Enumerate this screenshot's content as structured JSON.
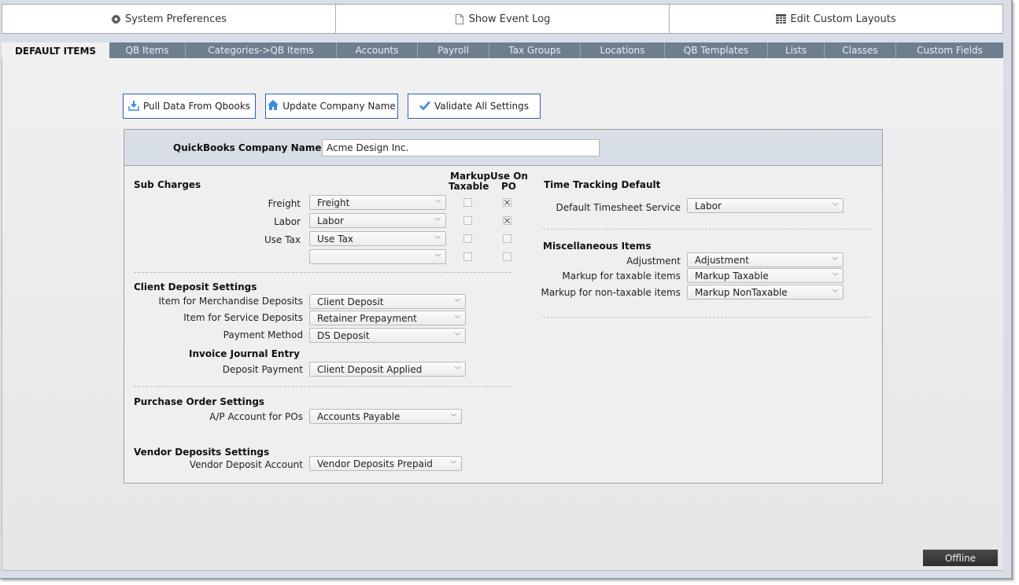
{
  "toolbar": {
    "items": [
      {
        "label": "System Preferences",
        "icon": "gear-icon"
      },
      {
        "label": "Show Event Log",
        "icon": "document-icon"
      },
      {
        "label": "Edit Custom Layouts",
        "icon": "table-icon"
      }
    ]
  },
  "tabs": [
    {
      "label": "DEFAULT ITEMS",
      "active": true
    },
    {
      "label": "QB Items"
    },
    {
      "label": "Categories->QB Items"
    },
    {
      "label": "Accounts"
    },
    {
      "label": "Payroll"
    },
    {
      "label": "Tax Groups"
    },
    {
      "label": "Locations"
    },
    {
      "label": "QB Templates"
    },
    {
      "label": "Lists"
    },
    {
      "label": "Classes"
    },
    {
      "label": "Custom Fields"
    }
  ],
  "actions": {
    "pull": {
      "label": "Pull Data From Qbooks",
      "icon": "download-icon"
    },
    "update": {
      "label": "Update Company Name",
      "icon": "home-icon"
    },
    "validate": {
      "label": "Validate All Settings",
      "icon": "checkmark-icon"
    }
  },
  "company": {
    "label": "QuickBooks Company Name",
    "value": "Acme Design Inc."
  },
  "sub_charges": {
    "title": "Sub Charges",
    "col_markup": [
      "Markup",
      "Taxable"
    ],
    "col_use_on": [
      "Use On",
      "PO"
    ],
    "rows": [
      {
        "label": "Freight",
        "value": "Freight",
        "markup_taxable": false,
        "use_on_po": true
      },
      {
        "label": "Labor",
        "value": "Labor",
        "markup_taxable": false,
        "use_on_po": true
      },
      {
        "label": "Use Tax",
        "value": "Use Tax",
        "markup_taxable": false,
        "use_on_po": false
      },
      {
        "label": "",
        "value": "",
        "markup_taxable": false,
        "use_on_po": false
      }
    ]
  },
  "client_deposit": {
    "title": "Client Deposit Settings",
    "merch_label": "Item for Merchandise Deposits",
    "merch_value": "Client Deposit",
    "service_label": "Item for Service Deposits",
    "service_value": "Retainer Prepayment",
    "payment_label": "Payment Method",
    "payment_value": "DS Deposit",
    "journal_title": "Invoice Journal Entry",
    "deposit_payment_label": "Deposit Payment",
    "deposit_payment_value": "Client Deposit Applied"
  },
  "purchase_order": {
    "title": "Purchase Order Settings",
    "ap_label": "A/P Account for POs",
    "ap_value": "Accounts Payable"
  },
  "vendor_deposits": {
    "title": "Vendor Deposits Settings",
    "account_label": "Vendor Deposit Account",
    "account_value": "Vendor Deposits Prepaid"
  },
  "time_tracking": {
    "title": "Time Tracking Default",
    "service_label": "Default Timesheet Service",
    "service_value": "Labor"
  },
  "misc": {
    "title": "Miscellaneous Items",
    "adjustment_label": "Adjustment",
    "adjustment_value": "Adjustment",
    "taxable_label": "Markup for taxable items",
    "taxable_value": "Markup Taxable",
    "nontaxable_label": "Markup for non-taxable items",
    "nontaxable_value": "Markup NonTaxable"
  },
  "status": {
    "label": "Offline"
  },
  "colors": {
    "tab_bar": "#6d7f8e",
    "button_border": "#2f63a8",
    "icon_blue": "#3b8be0",
    "status_bg": "#333333"
  }
}
